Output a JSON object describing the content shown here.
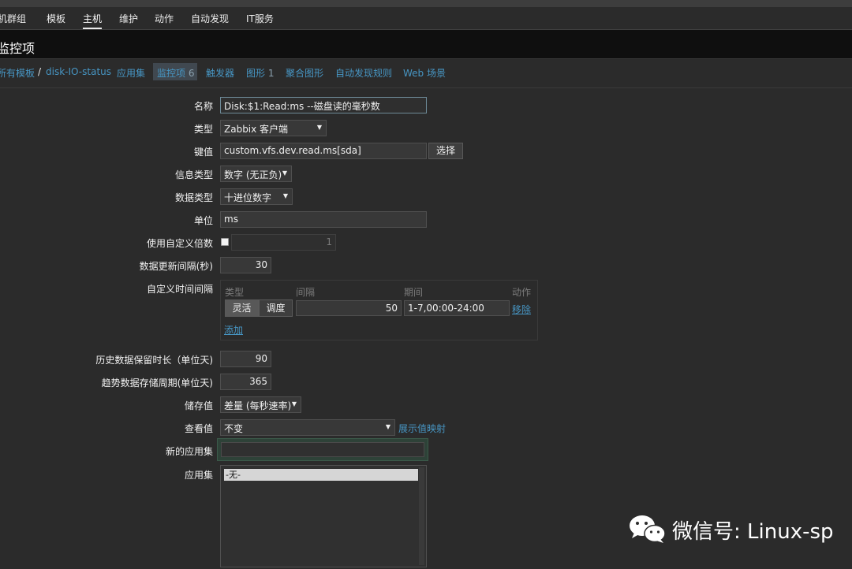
{
  "topnav": {
    "items": [
      "机群组",
      "模板",
      "主机",
      "维护",
      "动作",
      "自动发现",
      "IT服务"
    ],
    "active": "主机"
  },
  "page_title": "监控项",
  "subnav": {
    "all_templates": "所有模板",
    "separator": "/",
    "template_name": "disk-IO-status",
    "applications": "应用集",
    "items": "监控项",
    "items_count": "6",
    "triggers": "触发器",
    "graphs": "图形",
    "graphs_count": "1",
    "screens": "聚合图形",
    "discovery": "自动发现规则",
    "web": "Web 场景"
  },
  "form": {
    "name_label": "名称",
    "name_value": "Disk:$1:Read:ms --磁盘读的毫秒数",
    "type_label": "类型",
    "type_value": "Zabbix 客户端",
    "key_label": "键值",
    "key_value": "custom.vfs.dev.read.ms[sda]",
    "key_select_button": "选择",
    "info_type_label": "信息类型",
    "info_type_value": "数字 (无正负)",
    "data_type_label": "数据类型",
    "data_type_value": "十进位数字",
    "units_label": "单位",
    "units_value": "ms",
    "multiplier_label": "使用自定义倍数",
    "multiplier_value": "1",
    "multiplier_checked": false,
    "interval_label": "数据更新间隔(秒)",
    "interval_value": "30",
    "custom_intervals_label": "自定义时间间隔",
    "ci_headers": {
      "type": "类型",
      "interval": "间隔",
      "period": "期间",
      "action": "动作"
    },
    "ci_type_flexible": "灵活",
    "ci_type_scheduling": "调度",
    "ci_interval_value": "50",
    "ci_period_value": "1-7,00:00-24:00",
    "ci_remove": "移除",
    "ci_add": "添加",
    "history_label": "历史数据保留时长（单位天)",
    "history_value": "90",
    "trends_label": "趋势数据存储周期(单位天)",
    "trends_value": "365",
    "store_label": "储存值",
    "store_value": "差量 (每秒速率)",
    "show_value_label": "查看值",
    "show_value_value": "不变",
    "show_value_mappings_link": "展示值映射",
    "new_app_label": "新的应用集",
    "new_app_value": "",
    "apps_label": "应用集",
    "apps_options": [
      "-无-"
    ]
  },
  "watermark": "微信号: Linux-sp",
  "colors": {
    "link": "#4796c4",
    "background": "#2b2b2b",
    "titlebar": "#0f0f0f"
  }
}
